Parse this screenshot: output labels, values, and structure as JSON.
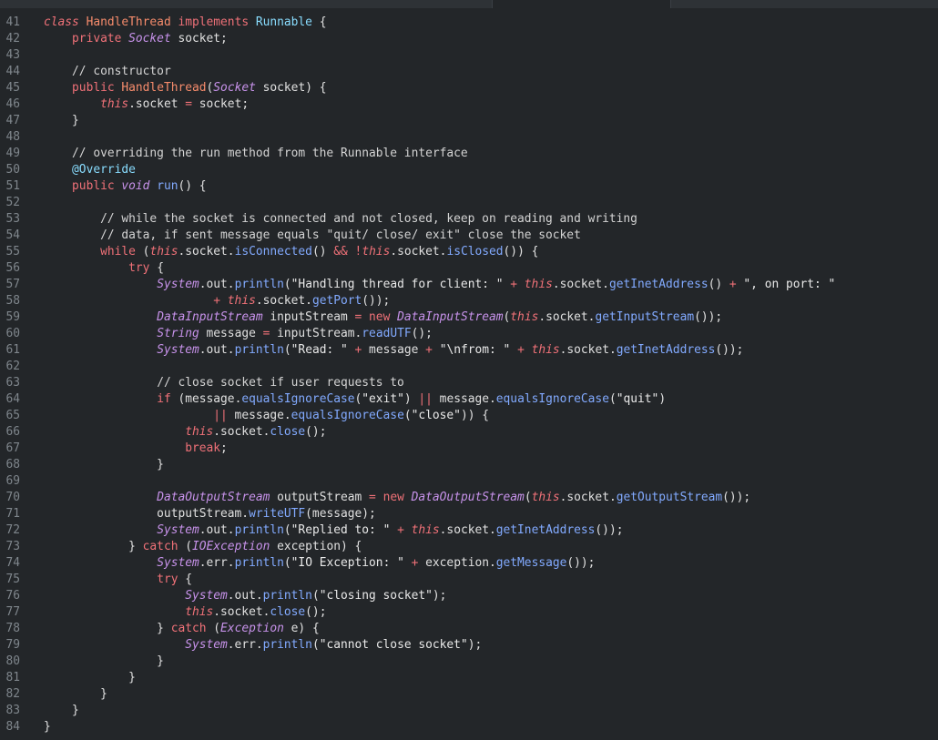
{
  "editor": {
    "lines": [
      {
        "n": "41",
        "t": [
          [
            "kw-it",
            "class"
          ],
          [
            "plain",
            " "
          ],
          [
            "cls",
            "HandleThread"
          ],
          [
            "plain",
            " "
          ],
          [
            "kw",
            "implements"
          ],
          [
            "plain",
            " "
          ],
          [
            "ann",
            "Runnable"
          ],
          [
            "plain",
            " {"
          ]
        ]
      },
      {
        "n": "42",
        "t": [
          [
            "plain",
            "    "
          ],
          [
            "kw",
            "private"
          ],
          [
            "plain",
            " "
          ],
          [
            "type",
            "Socket"
          ],
          [
            "plain",
            " socket;"
          ]
        ]
      },
      {
        "n": "43",
        "t": []
      },
      {
        "n": "44",
        "t": [
          [
            "plain",
            "    "
          ],
          [
            "com",
            "// constructor"
          ]
        ]
      },
      {
        "n": "45",
        "t": [
          [
            "plain",
            "    "
          ],
          [
            "kw",
            "public"
          ],
          [
            "plain",
            " "
          ],
          [
            "cls",
            "HandleThread"
          ],
          [
            "plain",
            "("
          ],
          [
            "type",
            "Socket"
          ],
          [
            "plain",
            " socket) {"
          ]
        ]
      },
      {
        "n": "46",
        "t": [
          [
            "plain",
            "        "
          ],
          [
            "kw-it",
            "this"
          ],
          [
            "plain",
            ".socket "
          ],
          [
            "op",
            "="
          ],
          [
            "plain",
            " socket;"
          ]
        ]
      },
      {
        "n": "47",
        "t": [
          [
            "plain",
            "    }"
          ]
        ]
      },
      {
        "n": "48",
        "t": []
      },
      {
        "n": "49",
        "t": [
          [
            "plain",
            "    "
          ],
          [
            "com",
            "// overriding the run method from the Runnable interface"
          ]
        ]
      },
      {
        "n": "50",
        "t": [
          [
            "plain",
            "    "
          ],
          [
            "ann",
            "@Override"
          ]
        ]
      },
      {
        "n": "51",
        "t": [
          [
            "plain",
            "    "
          ],
          [
            "kw",
            "public"
          ],
          [
            "plain",
            " "
          ],
          [
            "type",
            "void"
          ],
          [
            "plain",
            " "
          ],
          [
            "fn",
            "run"
          ],
          [
            "plain",
            "() {"
          ]
        ]
      },
      {
        "n": "52",
        "t": []
      },
      {
        "n": "53",
        "t": [
          [
            "plain",
            "        "
          ],
          [
            "com",
            "// while the socket is connected and not closed, keep on reading and writing"
          ]
        ]
      },
      {
        "n": "54",
        "t": [
          [
            "plain",
            "        "
          ],
          [
            "com",
            "// data, if sent message equals \"quit/ close/ exit\" close the socket"
          ]
        ]
      },
      {
        "n": "55",
        "t": [
          [
            "plain",
            "        "
          ],
          [
            "kw",
            "while"
          ],
          [
            "plain",
            " ("
          ],
          [
            "kw-it",
            "this"
          ],
          [
            "plain",
            ".socket."
          ],
          [
            "fn",
            "isConnected"
          ],
          [
            "plain",
            "() "
          ],
          [
            "op",
            "&&"
          ],
          [
            "plain",
            " "
          ],
          [
            "op",
            "!"
          ],
          [
            "kw-it",
            "this"
          ],
          [
            "plain",
            ".socket."
          ],
          [
            "fn",
            "isClosed"
          ],
          [
            "plain",
            "()) {"
          ]
        ]
      },
      {
        "n": "56",
        "t": [
          [
            "plain",
            "            "
          ],
          [
            "kw",
            "try"
          ],
          [
            "plain",
            " {"
          ]
        ]
      },
      {
        "n": "57",
        "t": [
          [
            "plain",
            "                "
          ],
          [
            "type",
            "System"
          ],
          [
            "plain",
            ".out."
          ],
          [
            "fn",
            "println"
          ],
          [
            "plain",
            "("
          ],
          [
            "str",
            "\"Handling thread for client: \""
          ],
          [
            "plain",
            " "
          ],
          [
            "op",
            "+"
          ],
          [
            "plain",
            " "
          ],
          [
            "kw-it",
            "this"
          ],
          [
            "plain",
            ".socket."
          ],
          [
            "fn",
            "getInetAddress"
          ],
          [
            "plain",
            "() "
          ],
          [
            "op",
            "+"
          ],
          [
            "plain",
            " "
          ],
          [
            "str",
            "\", on port: \""
          ]
        ]
      },
      {
        "n": "58",
        "t": [
          [
            "plain",
            "                        "
          ],
          [
            "op",
            "+"
          ],
          [
            "plain",
            " "
          ],
          [
            "kw-it",
            "this"
          ],
          [
            "plain",
            ".socket."
          ],
          [
            "fn",
            "getPort"
          ],
          [
            "plain",
            "());"
          ]
        ]
      },
      {
        "n": "59",
        "t": [
          [
            "plain",
            "                "
          ],
          [
            "type",
            "DataInputStream"
          ],
          [
            "plain",
            " inputStream "
          ],
          [
            "op",
            "="
          ],
          [
            "plain",
            " "
          ],
          [
            "kw",
            "new"
          ],
          [
            "plain",
            " "
          ],
          [
            "type",
            "DataInputStream"
          ],
          [
            "plain",
            "("
          ],
          [
            "kw-it",
            "this"
          ],
          [
            "plain",
            ".socket."
          ],
          [
            "fn",
            "getInputStream"
          ],
          [
            "plain",
            "());"
          ]
        ]
      },
      {
        "n": "60",
        "t": [
          [
            "plain",
            "                "
          ],
          [
            "type",
            "String"
          ],
          [
            "plain",
            " message "
          ],
          [
            "op",
            "="
          ],
          [
            "plain",
            " inputStream."
          ],
          [
            "fn",
            "readUTF"
          ],
          [
            "plain",
            "();"
          ]
        ]
      },
      {
        "n": "61",
        "t": [
          [
            "plain",
            "                "
          ],
          [
            "type",
            "System"
          ],
          [
            "plain",
            ".out."
          ],
          [
            "fn",
            "println"
          ],
          [
            "plain",
            "("
          ],
          [
            "str",
            "\"Read: \""
          ],
          [
            "plain",
            " "
          ],
          [
            "op",
            "+"
          ],
          [
            "plain",
            " message "
          ],
          [
            "op",
            "+"
          ],
          [
            "plain",
            " "
          ],
          [
            "str",
            "\"\\nfrom: \""
          ],
          [
            "plain",
            " "
          ],
          [
            "op",
            "+"
          ],
          [
            "plain",
            " "
          ],
          [
            "kw-it",
            "this"
          ],
          [
            "plain",
            ".socket."
          ],
          [
            "fn",
            "getInetAddress"
          ],
          [
            "plain",
            "());"
          ]
        ]
      },
      {
        "n": "62",
        "t": []
      },
      {
        "n": "63",
        "t": [
          [
            "plain",
            "                "
          ],
          [
            "com",
            "// close socket if user requests to"
          ]
        ]
      },
      {
        "n": "64",
        "t": [
          [
            "plain",
            "                "
          ],
          [
            "kw",
            "if"
          ],
          [
            "plain",
            " (message."
          ],
          [
            "fn",
            "equalsIgnoreCase"
          ],
          [
            "plain",
            "("
          ],
          [
            "str",
            "\"exit\""
          ],
          [
            "plain",
            ") "
          ],
          [
            "op",
            "||"
          ],
          [
            "plain",
            " message."
          ],
          [
            "fn",
            "equalsIgnoreCase"
          ],
          [
            "plain",
            "("
          ],
          [
            "str",
            "\"quit\""
          ],
          [
            "plain",
            ")"
          ]
        ]
      },
      {
        "n": "65",
        "t": [
          [
            "plain",
            "                        "
          ],
          [
            "op",
            "||"
          ],
          [
            "plain",
            " message."
          ],
          [
            "fn",
            "equalsIgnoreCase"
          ],
          [
            "plain",
            "("
          ],
          [
            "str",
            "\"close\""
          ],
          [
            "plain",
            ")) {"
          ]
        ]
      },
      {
        "n": "66",
        "t": [
          [
            "plain",
            "                    "
          ],
          [
            "kw-it",
            "this"
          ],
          [
            "plain",
            ".socket."
          ],
          [
            "fn",
            "close"
          ],
          [
            "plain",
            "();"
          ]
        ]
      },
      {
        "n": "67",
        "t": [
          [
            "plain",
            "                    "
          ],
          [
            "kw",
            "break"
          ],
          [
            "plain",
            ";"
          ]
        ]
      },
      {
        "n": "68",
        "t": [
          [
            "plain",
            "                }"
          ]
        ]
      },
      {
        "n": "69",
        "t": []
      },
      {
        "n": "70",
        "t": [
          [
            "plain",
            "                "
          ],
          [
            "type",
            "DataOutputStream"
          ],
          [
            "plain",
            " outputStream "
          ],
          [
            "op",
            "="
          ],
          [
            "plain",
            " "
          ],
          [
            "kw",
            "new"
          ],
          [
            "plain",
            " "
          ],
          [
            "type",
            "DataOutputStream"
          ],
          [
            "plain",
            "("
          ],
          [
            "kw-it",
            "this"
          ],
          [
            "plain",
            ".socket."
          ],
          [
            "fn",
            "getOutputStream"
          ],
          [
            "plain",
            "());"
          ]
        ]
      },
      {
        "n": "71",
        "t": [
          [
            "plain",
            "                outputStream."
          ],
          [
            "fn",
            "writeUTF"
          ],
          [
            "plain",
            "(message);"
          ]
        ]
      },
      {
        "n": "72",
        "t": [
          [
            "plain",
            "                "
          ],
          [
            "type",
            "System"
          ],
          [
            "plain",
            ".out."
          ],
          [
            "fn",
            "println"
          ],
          [
            "plain",
            "("
          ],
          [
            "str",
            "\"Replied to: \""
          ],
          [
            "plain",
            " "
          ],
          [
            "op",
            "+"
          ],
          [
            "plain",
            " "
          ],
          [
            "kw-it",
            "this"
          ],
          [
            "plain",
            ".socket."
          ],
          [
            "fn",
            "getInetAddress"
          ],
          [
            "plain",
            "());"
          ]
        ]
      },
      {
        "n": "73",
        "t": [
          [
            "plain",
            "            } "
          ],
          [
            "kw",
            "catch"
          ],
          [
            "plain",
            " ("
          ],
          [
            "type",
            "IOException"
          ],
          [
            "plain",
            " exception) {"
          ]
        ]
      },
      {
        "n": "74",
        "t": [
          [
            "plain",
            "                "
          ],
          [
            "type",
            "System"
          ],
          [
            "plain",
            ".err."
          ],
          [
            "fn",
            "println"
          ],
          [
            "plain",
            "("
          ],
          [
            "str",
            "\"IO Exception: \""
          ],
          [
            "plain",
            " "
          ],
          [
            "op",
            "+"
          ],
          [
            "plain",
            " exception."
          ],
          [
            "fn",
            "getMessage"
          ],
          [
            "plain",
            "());"
          ]
        ]
      },
      {
        "n": "75",
        "t": [
          [
            "plain",
            "                "
          ],
          [
            "kw",
            "try"
          ],
          [
            "plain",
            " {"
          ]
        ]
      },
      {
        "n": "76",
        "t": [
          [
            "plain",
            "                    "
          ],
          [
            "type",
            "System"
          ],
          [
            "plain",
            ".out."
          ],
          [
            "fn",
            "println"
          ],
          [
            "plain",
            "("
          ],
          [
            "str",
            "\"closing socket\""
          ],
          [
            "plain",
            ");"
          ]
        ]
      },
      {
        "n": "77",
        "t": [
          [
            "plain",
            "                    "
          ],
          [
            "kw-it",
            "this"
          ],
          [
            "plain",
            ".socket."
          ],
          [
            "fn",
            "close"
          ],
          [
            "plain",
            "();"
          ]
        ]
      },
      {
        "n": "78",
        "t": [
          [
            "plain",
            "                } "
          ],
          [
            "kw",
            "catch"
          ],
          [
            "plain",
            " ("
          ],
          [
            "type",
            "Exception"
          ],
          [
            "plain",
            " e) {"
          ]
        ]
      },
      {
        "n": "79",
        "t": [
          [
            "plain",
            "                    "
          ],
          [
            "type",
            "System"
          ],
          [
            "plain",
            ".err."
          ],
          [
            "fn",
            "println"
          ],
          [
            "plain",
            "("
          ],
          [
            "str",
            "\"cannot close socket\""
          ],
          [
            "plain",
            ");"
          ]
        ]
      },
      {
        "n": "80",
        "t": [
          [
            "plain",
            "                }"
          ]
        ]
      },
      {
        "n": "81",
        "t": [
          [
            "plain",
            "            }"
          ]
        ]
      },
      {
        "n": "82",
        "t": [
          [
            "plain",
            "        }"
          ]
        ]
      },
      {
        "n": "83",
        "t": [
          [
            "plain",
            "    }"
          ]
        ]
      },
      {
        "n": "84",
        "t": [
          [
            "plain",
            "}"
          ]
        ]
      }
    ]
  }
}
